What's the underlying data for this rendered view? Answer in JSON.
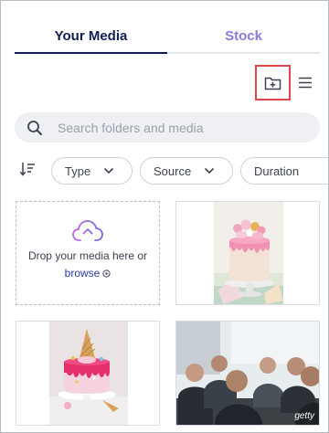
{
  "tabs": [
    {
      "label": "Your Media",
      "active": true
    },
    {
      "label": "Stock",
      "active": false
    }
  ],
  "actions": {
    "new_folder_icon": "folder-plus-icon",
    "menu_icon": "hamburger-icon"
  },
  "search": {
    "placeholder": "Search folders and media",
    "icon": "search-icon"
  },
  "filters": {
    "sort_icon": "sort-icon",
    "chips": [
      {
        "label": "Type"
      },
      {
        "label": "Source"
      },
      {
        "label": "Duration"
      }
    ]
  },
  "dropzone": {
    "text": "Drop your media here or",
    "link": "browse",
    "icon": "cloud-upload-icon"
  },
  "media": [
    {
      "kind": "image",
      "subject": "pink drip cake with macarons"
    },
    {
      "kind": "image",
      "subject": "pink cake with ice cream cone"
    },
    {
      "kind": "image",
      "subject": "business meeting",
      "watermark": "getty"
    }
  ],
  "colors": {
    "accent": "#0f1e54",
    "stock_tab": "#8b7bd6",
    "highlight": "#e0474c",
    "link": "#2a3fa6",
    "cloud": "#9c6bd6"
  }
}
